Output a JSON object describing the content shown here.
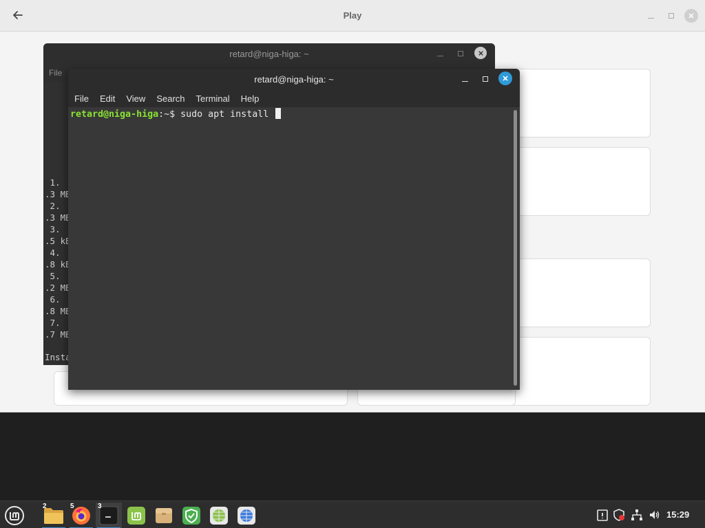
{
  "play_window": {
    "title": "Play"
  },
  "back_terminal": {
    "title": "retard@niga-higa: ~",
    "menu_file": "File",
    "lines": [
      " 1.",
      ".3 MB",
      " 2.",
      ".3 MB",
      " 3.",
      ".5 kB",
      " 4.",
      ".8 kB",
      " 5.",
      ".2 MB",
      " 6.",
      ".8 MB",
      " 7.",
      ".7 MB",
      "Insta"
    ]
  },
  "front_terminal": {
    "title": "retard@niga-higa: ~",
    "menu": [
      "File",
      "Edit",
      "View",
      "Search",
      "Terminal",
      "Help"
    ],
    "prompt_user": "retard@niga-higa",
    "prompt_suffix": ":~$ ",
    "command": "sudo apt install "
  },
  "taskbar": {
    "apps": [
      {
        "name": "files",
        "badge": "2"
      },
      {
        "name": "firefox",
        "badge": "5"
      },
      {
        "name": "terminal",
        "badge": "3"
      },
      {
        "name": "mintupdate",
        "badge": ""
      },
      {
        "name": "archive-manager",
        "badge": ""
      },
      {
        "name": "shield",
        "badge": ""
      },
      {
        "name": "web-green",
        "badge": ""
      },
      {
        "name": "web-blue",
        "badge": ""
      }
    ],
    "clock": "15:29"
  },
  "colors": {
    "prompt_green": "#8ae234",
    "close_blue": "#2e9ad8",
    "active_underline": "#3d8fd1"
  }
}
